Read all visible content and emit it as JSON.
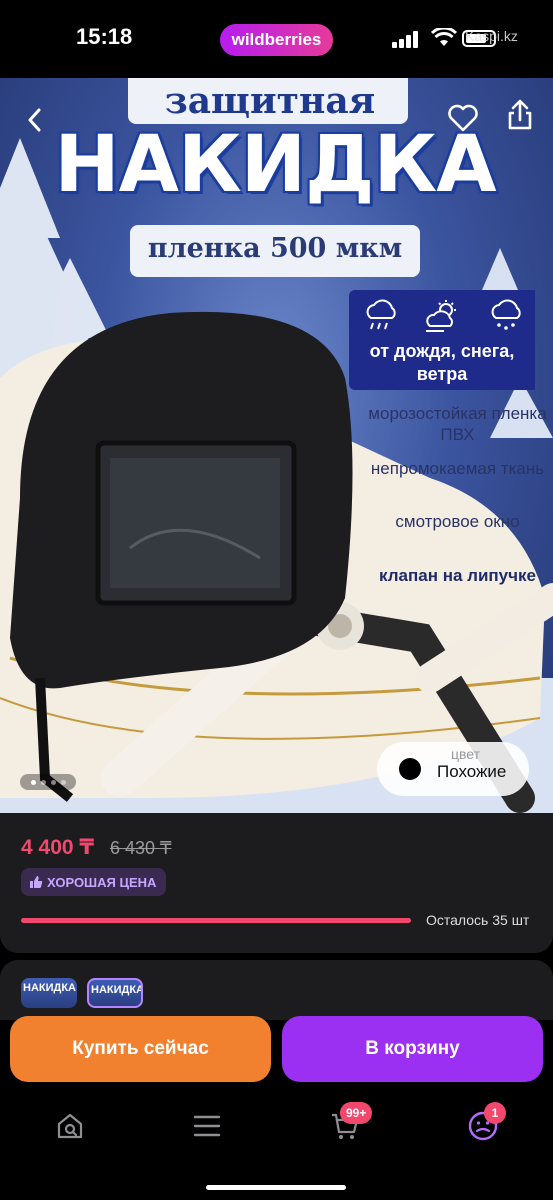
{
  "status_bar": {
    "time": "15:18",
    "app_pill": "wildberries",
    "watermark": "Kaspi.kz"
  },
  "hero": {
    "title_top": "защитная",
    "title_main": "НАКИДКА",
    "subtitle": "пленка 500 мкм",
    "weather_caption": "от дождя, снега, ветра",
    "weather_icons": [
      "rain-cloud-icon",
      "sun-cloud-icon",
      "snow-cloud-icon"
    ],
    "features": [
      {
        "text": "морозостойкая пленка ПВХ",
        "bold": false
      },
      {
        "text": "непромокаемая ткань",
        "bold": false
      },
      {
        "text": "смотровое окно",
        "bold": false
      },
      {
        "text": "клапан на липучке",
        "bold": true
      }
    ],
    "gallery": {
      "total": 4,
      "current": 1
    },
    "similar": {
      "ghost_label": "цвет",
      "label": "Похожие"
    }
  },
  "price_card": {
    "price": "4 400 ₸",
    "old_price": "6 430 ₸",
    "badge": "ХОРОШАЯ ЦЕНА",
    "stock_text": "Осталось 35 шт",
    "colors": {
      "price": "#f2486d",
      "badge_text": "#c7a7ff"
    }
  },
  "thumbnails": [
    {
      "label": "НАКИДКА",
      "selected": false
    },
    {
      "label": "НАКИДКА",
      "selected": true
    }
  ],
  "actions": {
    "buy_now": "Купить сейчас",
    "add_to_cart": "В корзину",
    "colors": {
      "buy_now": "#f1812e",
      "add_to_cart": "#9b2ff2"
    }
  },
  "nav": {
    "items": [
      {
        "name": "home-search-icon"
      },
      {
        "name": "menu-icon"
      },
      {
        "name": "cart-icon",
        "badge": "99+"
      },
      {
        "name": "profile-icon",
        "badge": "1"
      }
    ]
  }
}
